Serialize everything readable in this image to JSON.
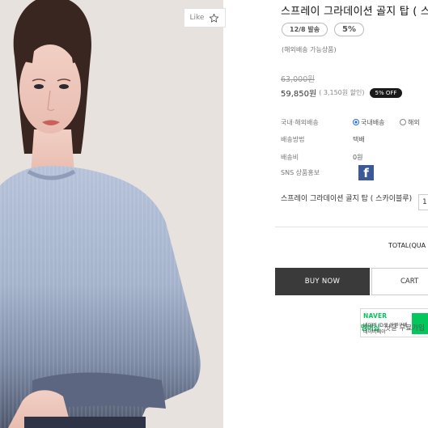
{
  "like": {
    "label": "Like",
    "icon": "star-outline-icon"
  },
  "product": {
    "title": "스프레이 그라데이션 골지 탑 ( 스",
    "ship_badge": "12/8 발송",
    "discount_badge": "5%",
    "overseas_note": "(해외배송 가능상품)",
    "original_price": "63,000원",
    "sale_price": "59,850원",
    "discount_note": "( 3,150원 할인)",
    "off_badge": "5% OFF"
  },
  "details": [
    {
      "label": "국내·해외배송",
      "options": [
        "국내배송",
        "해외"
      ],
      "selected": 0
    },
    {
      "label": "배송방법",
      "value": "택배"
    },
    {
      "label": "배송비",
      "value": "0원"
    },
    {
      "label": "SNS 상품홍보",
      "icon": "facebook-icon",
      "icon_glyph": "f"
    }
  ],
  "option_line": {
    "name": "스프레이 그라데이션 골지 탑 ( 스카이블루)",
    "qty": "1"
  },
  "total_label": "TOTAL(QUA",
  "buttons": {
    "buy_now": "BUY NOW",
    "cart": "CART"
  },
  "naver": {
    "logo": "NAVER",
    "line1": "네이버 ID로 간편구매",
    "line2": "네이버페이",
    "membership": "멤버십",
    "membership_text": "첫달 무료가입"
  },
  "colors": {
    "buy_now_bg": "#3a3a3a",
    "naver_green": "#03c75a",
    "facebook": "#3b5998"
  }
}
